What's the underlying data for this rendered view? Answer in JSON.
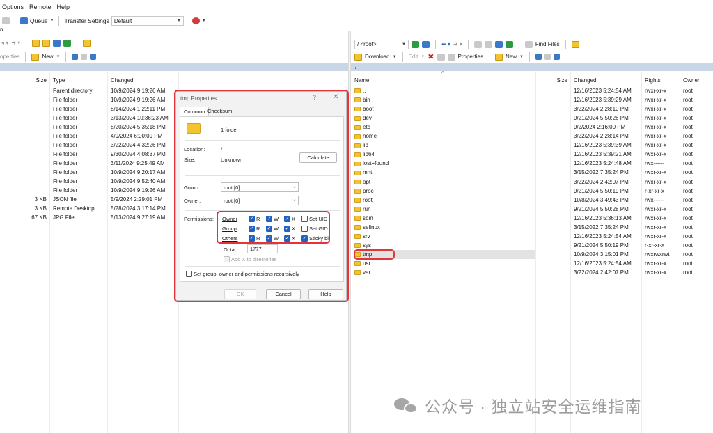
{
  "menu": [
    "Options",
    "Remote",
    "Help"
  ],
  "toolbar": {
    "queue_label": "Queue",
    "transfer_label": "Transfer Settings",
    "transfer_value": "Default"
  },
  "left_toolbar": {
    "properties_label": "operties",
    "new_label": "New"
  },
  "left_edge_label": "n",
  "right_toolbar": {
    "path_value": "/ <root>",
    "find_files_label": "Find Files",
    "download_label": "Download",
    "edit_label": "Edit",
    "properties_label": "Properties",
    "new_label": "New"
  },
  "right_path": "/",
  "left_pane": {
    "headers": {
      "size": "Size",
      "type": "Type",
      "changed": "Changed"
    },
    "rows": [
      {
        "size": "",
        "type": "Parent directory",
        "changed": "10/9/2024 9:19:26 AM"
      },
      {
        "size": "",
        "type": "File folder",
        "changed": "10/9/2024 9:19:26 AM"
      },
      {
        "size": "",
        "type": "File folder",
        "changed": "8/14/2024 1:22:11 PM"
      },
      {
        "size": "",
        "type": "File folder",
        "changed": "3/13/2024 10:36:23 AM"
      },
      {
        "size": "",
        "type": "File folder",
        "changed": "8/20/2024 5:35:18 PM"
      },
      {
        "size": "",
        "type": "File folder",
        "changed": "4/9/2024 6:00:09 PM"
      },
      {
        "size": "",
        "type": "File folder",
        "changed": "3/22/2024 4:32:26 PM"
      },
      {
        "size": "",
        "type": "File folder",
        "changed": "9/30/2024 4:08:37 PM"
      },
      {
        "size": "",
        "type": "File folder",
        "changed": "3/11/2024 9:25:49 AM"
      },
      {
        "size": "",
        "type": "File folder",
        "changed": "10/9/2024 9:20:17 AM"
      },
      {
        "size": "",
        "type": "File folder",
        "changed": "10/9/2024 9:52:40 AM"
      },
      {
        "size": "",
        "type": "File folder",
        "changed": "10/9/2024 9:19:26 AM"
      },
      {
        "size": "3 KB",
        "type": "JSON file",
        "changed": "5/9/2024 2:29:01 PM"
      },
      {
        "size": "3 KB",
        "type": "Remote Desktop ...",
        "changed": "5/28/2024 3:17:14 PM"
      },
      {
        "size": "67 KB",
        "type": "JPG File",
        "changed": "5/13/2024 9:27:19 AM"
      }
    ]
  },
  "right_pane": {
    "headers": {
      "name": "Name",
      "size": "Size",
      "changed": "Changed",
      "rights": "Rights",
      "owner": "Owner"
    },
    "rows": [
      {
        "name": "..",
        "changed": "12/16/2023 5:24:54 AM",
        "rights": "rwxr-xr-x",
        "owner": "root"
      },
      {
        "name": "bin",
        "changed": "12/16/2023 5:39:29 AM",
        "rights": "rwxr-xr-x",
        "owner": "root"
      },
      {
        "name": "boot",
        "changed": "3/22/2024 2:28:10 PM",
        "rights": "rwxr-xr-x",
        "owner": "root"
      },
      {
        "name": "dev",
        "changed": "9/21/2024 5:50:26 PM",
        "rights": "rwxr-xr-x",
        "owner": "root"
      },
      {
        "name": "etc",
        "changed": "9/2/2024 2:16:00 PM",
        "rights": "rwxr-xr-x",
        "owner": "root"
      },
      {
        "name": "home",
        "changed": "3/22/2024 2:28:14 PM",
        "rights": "rwxr-xr-x",
        "owner": "root"
      },
      {
        "name": "lib",
        "changed": "12/16/2023 5:39:39 AM",
        "rights": "rwxr-xr-x",
        "owner": "root"
      },
      {
        "name": "lib64",
        "changed": "12/16/2023 5:39:21 AM",
        "rights": "rwxr-xr-x",
        "owner": "root"
      },
      {
        "name": "lost+found",
        "changed": "12/16/2023 5:24:48 AM",
        "rights": "rwx------",
        "owner": "root"
      },
      {
        "name": "mnt",
        "changed": "3/15/2022 7:35:24 PM",
        "rights": "rwxr-xr-x",
        "owner": "root"
      },
      {
        "name": "opt",
        "changed": "3/22/2024 2:42:07 PM",
        "rights": "rwxr-xr-x",
        "owner": "root"
      },
      {
        "name": "proc",
        "changed": "9/21/2024 5:50:19 PM",
        "rights": "r-xr-xr-x",
        "owner": "root"
      },
      {
        "name": "root",
        "changed": "10/8/2024 3:49:43 PM",
        "rights": "rwx------",
        "owner": "root"
      },
      {
        "name": "run",
        "changed": "9/21/2024 5:50:28 PM",
        "rights": "rwxr-xr-x",
        "owner": "root"
      },
      {
        "name": "sbin",
        "changed": "12/16/2023 5:36:13 AM",
        "rights": "rwxr-xr-x",
        "owner": "root"
      },
      {
        "name": "selinux",
        "changed": "3/15/2022 7:35:24 PM",
        "rights": "rwxr-xr-x",
        "owner": "root"
      },
      {
        "name": "srv",
        "changed": "12/16/2023 5:24:54 AM",
        "rights": "rwxr-xr-x",
        "owner": "root"
      },
      {
        "name": "sys",
        "changed": "9/21/2024 5:50:19 PM",
        "rights": "r-xr-xr-x",
        "owner": "root"
      },
      {
        "name": "tmp",
        "changed": "10/9/2024 3:15:01 PM",
        "rights": "rwxrwxrwt",
        "owner": "root"
      },
      {
        "name": "usr",
        "changed": "12/16/2023 5:24:54 AM",
        "rights": "rwxr-xr-x",
        "owner": "root"
      },
      {
        "name": "var",
        "changed": "3/22/2024 2:42:07 PM",
        "rights": "rwxr-xr-x",
        "owner": "root"
      }
    ]
  },
  "dialog": {
    "title": "tmp Properties",
    "help_glyph": "?",
    "close_glyph": "✕",
    "tabs": [
      "Common",
      "Checksum"
    ],
    "summary": "1 folder",
    "location_label": "Location:",
    "location_value": "/",
    "size_label": "Size:",
    "size_value": "Unknown",
    "calculate_label": "Calculate",
    "group_label": "Group:",
    "group_value": "root [0]",
    "owner_label": "Owner:",
    "owner_value": "root [0]",
    "permissions_label": "Permissions:",
    "perm_rows": [
      {
        "label": "Owner",
        "r": "R",
        "w": "W",
        "x": "X",
        "special": "Set UID",
        "special_checked": false
      },
      {
        "label": "Group",
        "r": "R",
        "w": "W",
        "x": "X",
        "special": "Set GID",
        "special_checked": false
      },
      {
        "label": "Others",
        "r": "R",
        "w": "W",
        "x": "X",
        "special": "Sticky bit",
        "special_checked": true
      }
    ],
    "octal_label": "Octal:",
    "octal_value": "1777",
    "add_x_label": "Add X to directories",
    "recursive_label": "Set group, owner and permissions recursively",
    "ok_label": "OK",
    "cancel_label": "Cancel",
    "help_label": "Help"
  },
  "watermark": "公众号 · 独立站安全运维指南",
  "colors": {
    "highlight_red": "#e0353b",
    "checkbox_blue": "#1f62c2",
    "path_bar": "#c9d6e6"
  }
}
